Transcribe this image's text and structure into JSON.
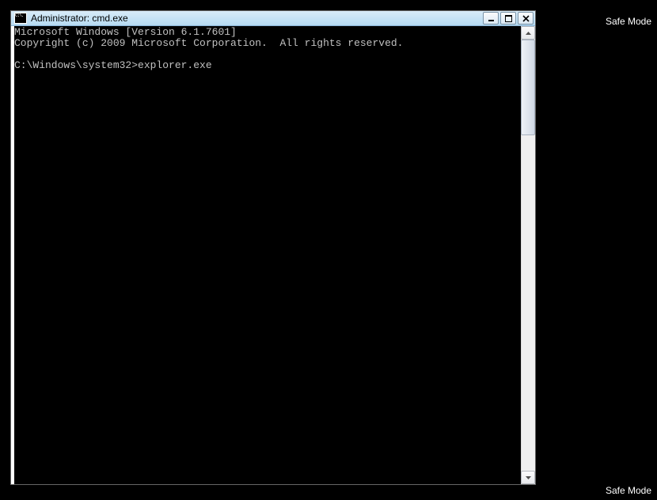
{
  "desktop": {
    "safemode_top": "Safe Mode",
    "safemode_bottom": "Safe Mode"
  },
  "window": {
    "title": "Administrator: cmd.exe",
    "icon_label": "C:\\."
  },
  "console": {
    "line1": "Microsoft Windows [Version 6.1.7601]",
    "line2": "Copyright (c) 2009 Microsoft Corporation.  All rights reserved.",
    "blank": "",
    "prompt_line": "C:\\Windows\\system32>explorer.exe"
  }
}
